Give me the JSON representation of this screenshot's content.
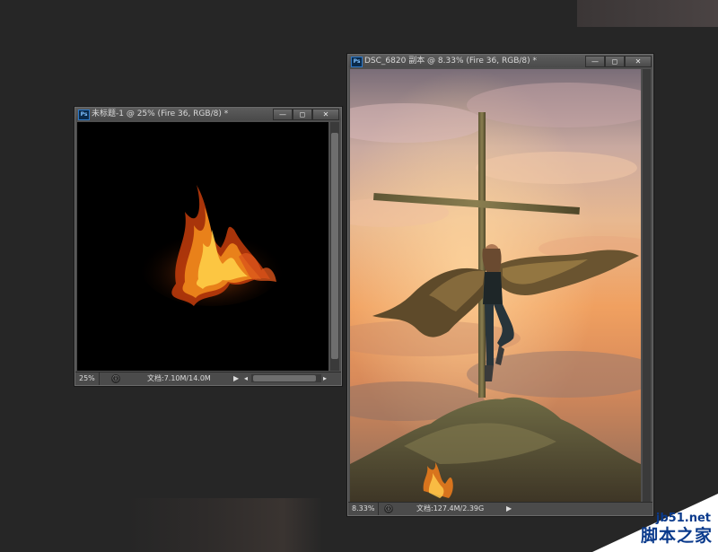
{
  "window_fire": {
    "app_logo": "Ps",
    "title": "未标题-1 @ 25% (Fire 36, RGB/8) *",
    "controls": {
      "minimize": "—",
      "restore": "◻",
      "close": "✕"
    },
    "status": {
      "zoom": "25%",
      "doc_info": "文档:7.10M/14.0M"
    }
  },
  "window_photo": {
    "app_logo": "Ps",
    "title": "DSC_6820 副本 @ 8.33% (Fire 36, RGB/8) *",
    "controls": {
      "minimize": "—",
      "restore": "◻",
      "close": "✕"
    },
    "status": {
      "zoom": "8.33%",
      "doc_info": "文档:127.4M/2.39G"
    }
  },
  "icons": {
    "info": "ⓘ",
    "arrow_right": "▶",
    "arrow_left": "◂",
    "arrow_right_small": "▸"
  },
  "watermark": {
    "url": "jb51.net",
    "text": "脚本之家"
  },
  "colors": {
    "workspace": "#262626",
    "panel": "#4e4e4e",
    "watermark_blue": "#0a3a8c"
  }
}
